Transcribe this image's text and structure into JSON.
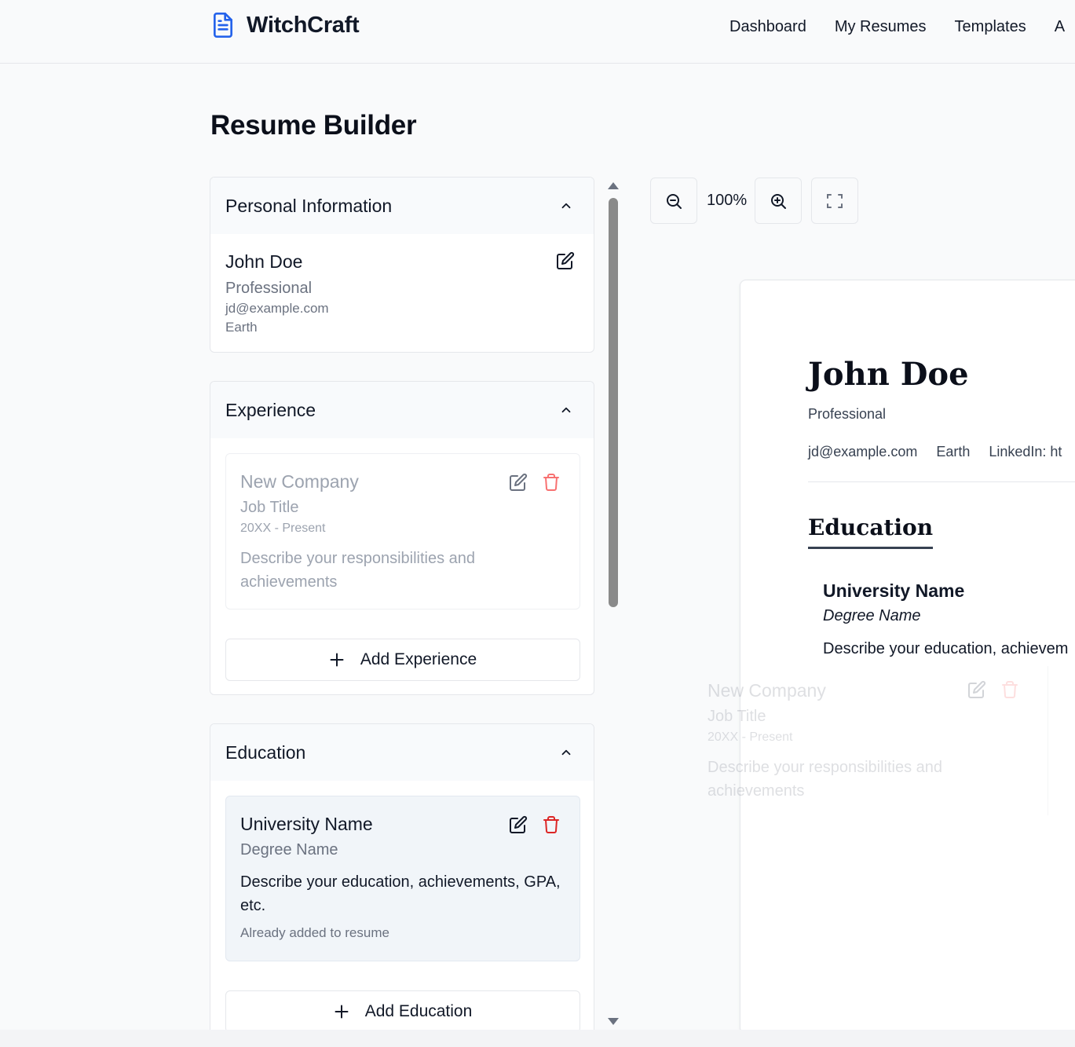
{
  "app": {
    "name": "WitchCraft"
  },
  "nav": {
    "items": [
      "Dashboard",
      "My Resumes",
      "Templates",
      "A"
    ]
  },
  "page": {
    "title": "Resume Builder"
  },
  "personal": {
    "heading": "Personal Information",
    "name": "John Doe",
    "title": "Professional",
    "email": "jd@example.com",
    "location": "Earth"
  },
  "experience": {
    "heading": "Experience",
    "item": {
      "company": "New Company",
      "job_title": "Job Title",
      "dates": "20XX - Present",
      "description": "Describe your responsibilities and achievements"
    },
    "add_label": "Add Experience"
  },
  "education": {
    "heading": "Education",
    "item": {
      "school": "University Name",
      "degree": "Degree Name",
      "description": "Describe your education, achievements, GPA, etc.",
      "status": "Already added to resume"
    },
    "add_label": "Add Education"
  },
  "preview": {
    "zoom": "100%",
    "name": "John Doe",
    "title": "Professional",
    "email": "jd@example.com",
    "location": "Earth",
    "linkedin": "LinkedIn: ht",
    "section_heading": "Education",
    "edu_school": "University Name",
    "edu_degree": "Degree Name",
    "edu_desc": "Describe your education, achievem"
  },
  "drag_ghost": {
    "company": "New Company",
    "job_title": "Job Title",
    "dates": "20XX - Present",
    "description": "Describe your responsibilities and achievements"
  },
  "colors": {
    "accent": "#2563eb",
    "danger": "#dc2626",
    "muted": "#6b7280"
  },
  "icons": [
    "document-icon",
    "chevron-up-icon",
    "edit-icon",
    "trash-icon",
    "plus-icon",
    "zoom-out-icon",
    "zoom-in-icon",
    "fullscreen-icon"
  ]
}
